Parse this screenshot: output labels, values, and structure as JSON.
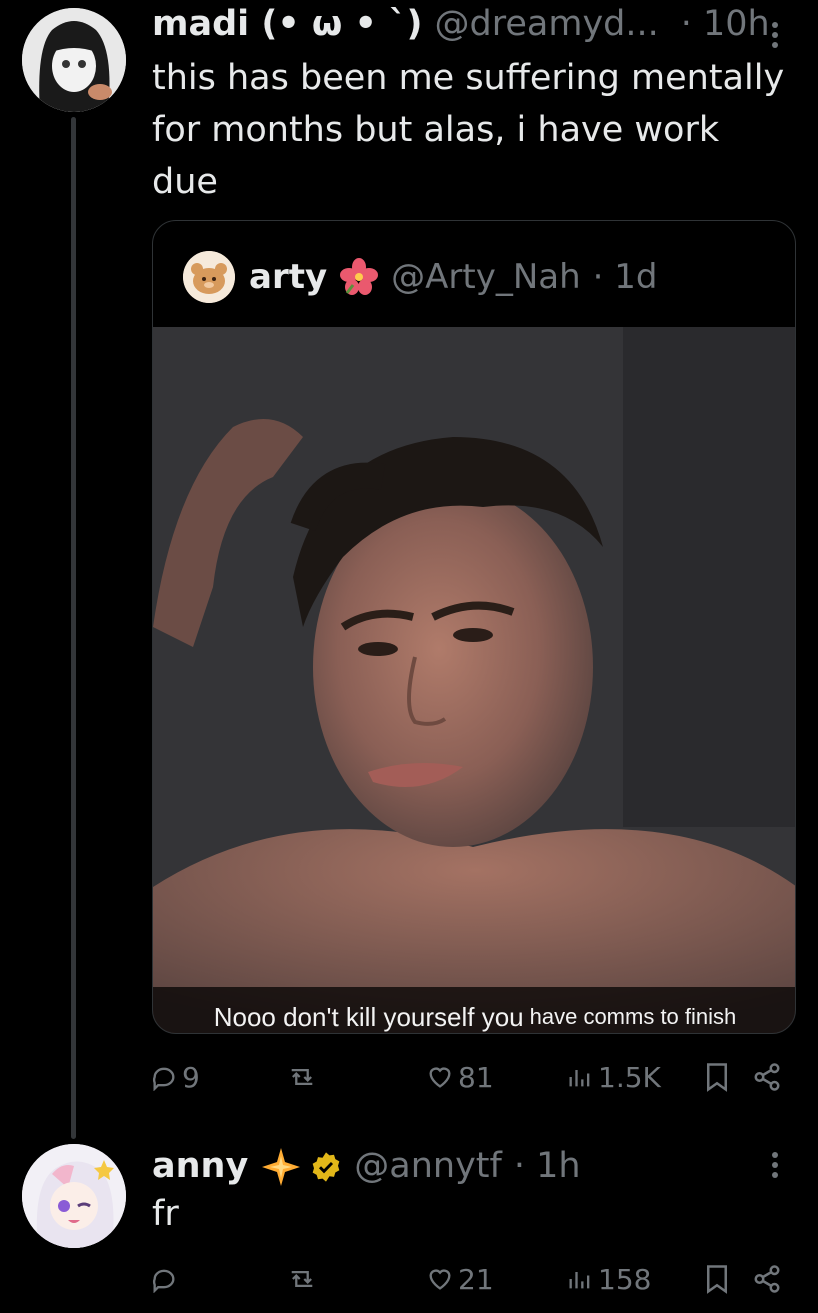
{
  "tweet1": {
    "author_name": "madi (• ω • `)",
    "handle": "@dreamyd...",
    "time": "· 10h",
    "text": "this has been me suffering mentally\nfor months but alas, i have work\ndue",
    "quote": {
      "author_name": "arty",
      "author_emoji": "flower-emoji",
      "handle": "@Arty_Nah",
      "time": "· 1d",
      "caption_main": "Nooo don't kill yourself you",
      "caption_small": "have comms to finish"
    },
    "actions": {
      "replies": "9",
      "reposts": "",
      "likes": "81",
      "views": "1.5K"
    }
  },
  "tweet2": {
    "author_name": "anny",
    "author_emoji": "sparkle-emoji",
    "handle": "@annytf",
    "time": "· 1h",
    "text": "fr",
    "actions": {
      "replies": "",
      "reposts": "",
      "likes": "21",
      "views": "158"
    }
  },
  "colors": {
    "background": "#000000",
    "text": "#e7e9ea",
    "secondary": "#71767b",
    "border": "#2f3336",
    "verified": "#e2b719"
  }
}
